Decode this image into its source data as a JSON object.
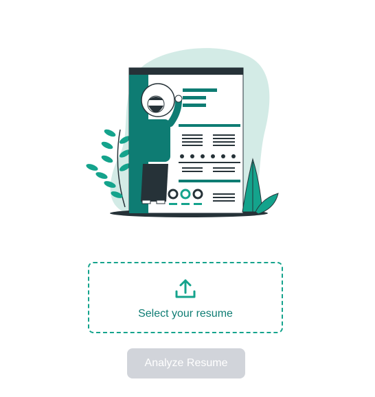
{
  "upload": {
    "label": "Select your resume",
    "icon": "upload-icon"
  },
  "actions": {
    "analyze_label": "Analyze Resume",
    "analyze_enabled": false
  },
  "illustration": {
    "icon": "resume-illustration"
  },
  "colors": {
    "accent": "#14a38c",
    "accent_dark": "#0e7c73",
    "blob": "#d3ebe6",
    "button_disabled": "#d1d4da",
    "dark": "#263238"
  }
}
